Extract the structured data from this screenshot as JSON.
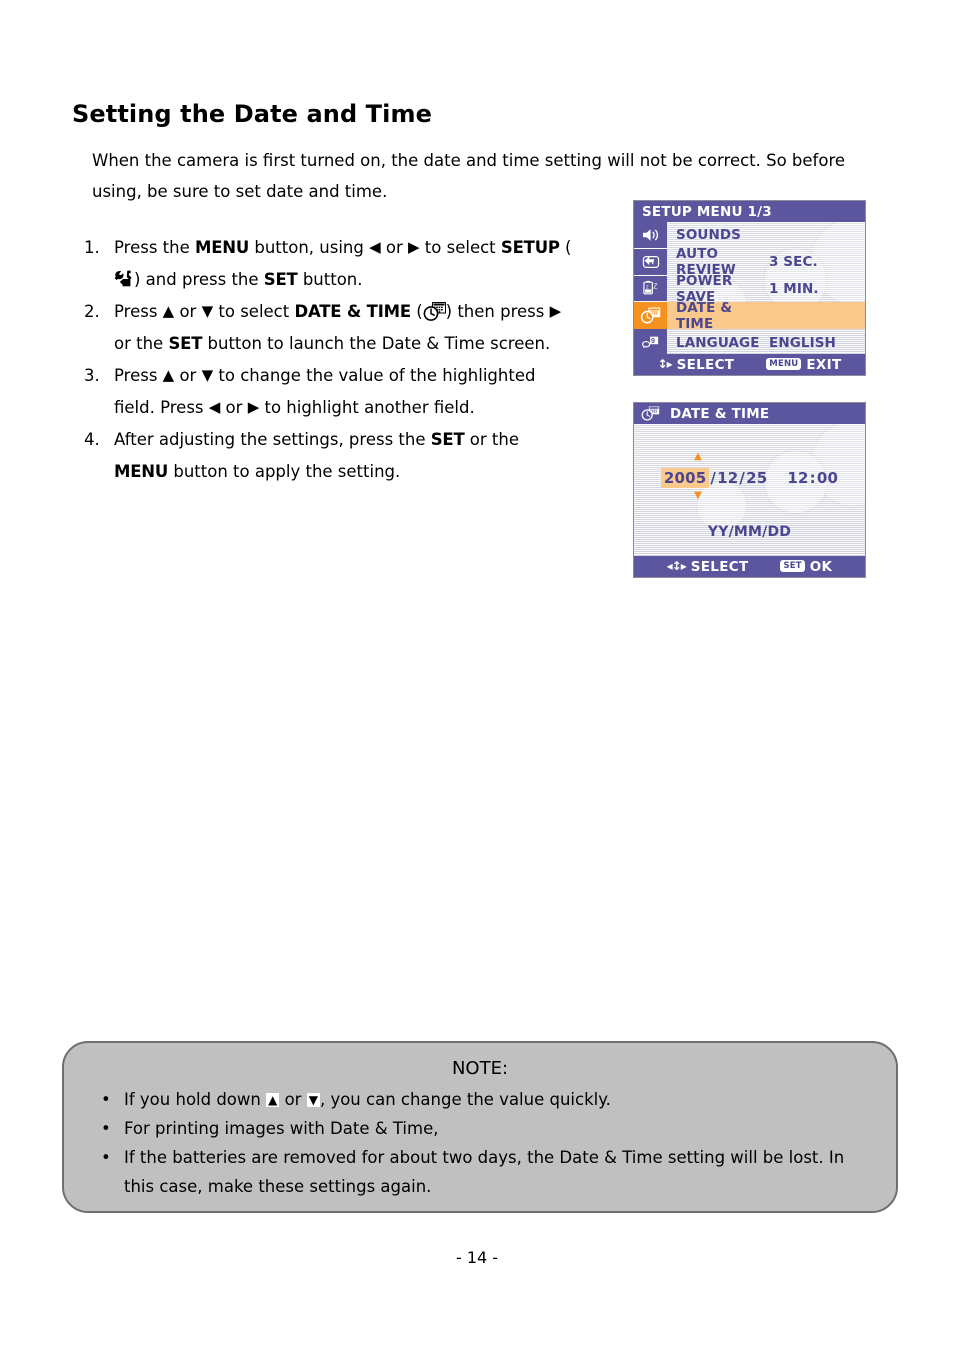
{
  "page": {
    "title": "Setting the Date and Time",
    "footer": "- 14 -"
  },
  "intro": {
    "text": "When the camera is first turned on, the date and time setting will not be correct. So before using, be sure to set date and time."
  },
  "steps": [
    {
      "num": "1.",
      "part1": "Press the ",
      "kbd1": "MENU",
      "part2": " button, using ",
      "arrow_left": "◀",
      "part3": " or ",
      "arrow_right": "▶",
      "part4": " to select ",
      "kbd2": "SETUP",
      "part5": " (",
      "icon": "setup-tools-icon",
      "part6": ") and press the ",
      "kbd3": "SET",
      "part7": " button."
    },
    {
      "num": "2.",
      "part1": "Press ",
      "arrow_up": "▲",
      "part2": " or ",
      "arrow_down": "▼",
      "part3": " to select ",
      "kbd1": "DATE & TIME",
      "part4": " (",
      "icon": "date-time-icon",
      "part5": ") then press ",
      "arrow_right": "▶",
      "part6": " or the ",
      "kbd2": "SET",
      "part7": " button to launch the Date & Time screen."
    },
    {
      "num": "3.",
      "part1": "Press ",
      "arrow_up": "▲",
      "part2": " or ",
      "arrow_down": "▼",
      "part3": " to change the value of the highlighted field.   Press ",
      "arrow_left": "◀",
      "part4": " or ",
      "arrow_right": "▶",
      "part5": " to highlight another field."
    },
    {
      "num": "4.",
      "part1": "After adjusting the settings, press the ",
      "kbd1": "SET",
      "part2": " or the ",
      "kbd2": "MENU",
      "part3": " button to apply the setting."
    }
  ],
  "lcd_setup": {
    "title": "SETUP MENU 1/3",
    "rows": [
      {
        "icon": "speaker-icon",
        "label": "SOUNDS",
        "value": ""
      },
      {
        "icon": "auto-review-icon",
        "label": "AUTO REVIEW",
        "value": "3 SEC."
      },
      {
        "icon": "power-save-icon",
        "label": "POWER SAVE",
        "value": "1 MIN."
      },
      {
        "icon": "date-time-icon",
        "label": "DATE & TIME",
        "value": "",
        "selected": true
      },
      {
        "icon": "language-icon",
        "label": "LANGUAGE",
        "value": "ENGLISH"
      }
    ],
    "status": {
      "nav_glyph": "↕▸",
      "select_label": "SELECT",
      "menu_badge": "MENU",
      "exit_label": "EXIT"
    }
  },
  "lcd_datetime": {
    "title": "DATE & TIME",
    "title_icon": "date-time-icon",
    "year": "2005",
    "sep1": "/",
    "month": "12",
    "sep2": "/",
    "day": "25",
    "hour": "12",
    "time_sep": ":",
    "minute": "00",
    "caret_up": "▲",
    "caret_down": "▼",
    "format": "YY/MM/DD",
    "status": {
      "nav_glyph": "◂↕▸",
      "select_label": "SELECT",
      "set_badge": "SET",
      "ok_label": "OK"
    }
  },
  "note": {
    "title": "NOTE:",
    "bullet": "•",
    "items": [
      {
        "part1": "If you hold down ",
        "glyph_up": "▲",
        "part2": " or ",
        "glyph_down": "▼",
        "part3": ", you can change the value quickly."
      },
      {
        "part1": "For printing images with Date & Time,"
      },
      {
        "part1": "If the batteries are removed for about two days, the Date & Time setting will be lost. In this case, make these settings again."
      }
    ]
  },
  "colors": {
    "lcd_purple": "#5b569d",
    "lcd_text_purple": "#4a4690",
    "highlight_orange": "#f5911e",
    "highlight_peach": "#fcc98d",
    "note_bg": "#c0c0c0"
  }
}
